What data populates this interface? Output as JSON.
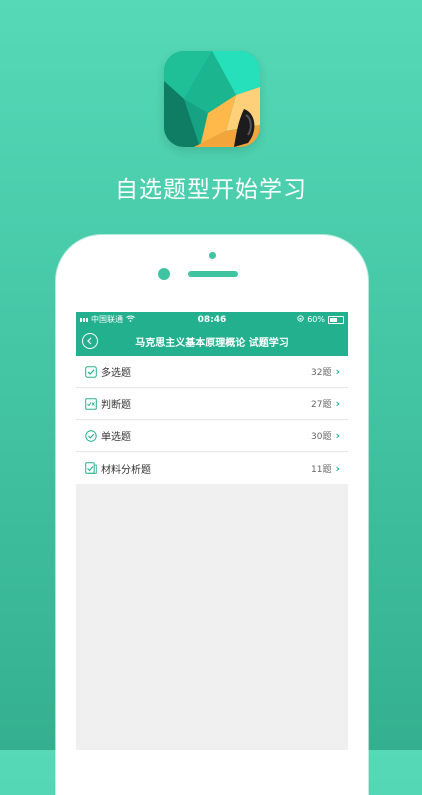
{
  "tagline": "自选题型开始学习",
  "status_bar": {
    "carrier": "中国联通",
    "time": "08:46",
    "battery": "60%"
  },
  "nav": {
    "title": "马克思主义基本原理概论 试题学习"
  },
  "question_types": [
    {
      "label": "多选题",
      "count": "32题",
      "icon": "checkbox-icon"
    },
    {
      "label": "判断题",
      "count": "27题",
      "icon": "true-false-icon"
    },
    {
      "label": "单选题",
      "count": "30题",
      "icon": "radio-check-icon"
    },
    {
      "label": "材料分析题",
      "count": "11题",
      "icon": "document-check-icon"
    }
  ],
  "colors": {
    "brand": "#23b08f",
    "background_top": "#55d9b7",
    "background_bottom": "#34b08f"
  }
}
